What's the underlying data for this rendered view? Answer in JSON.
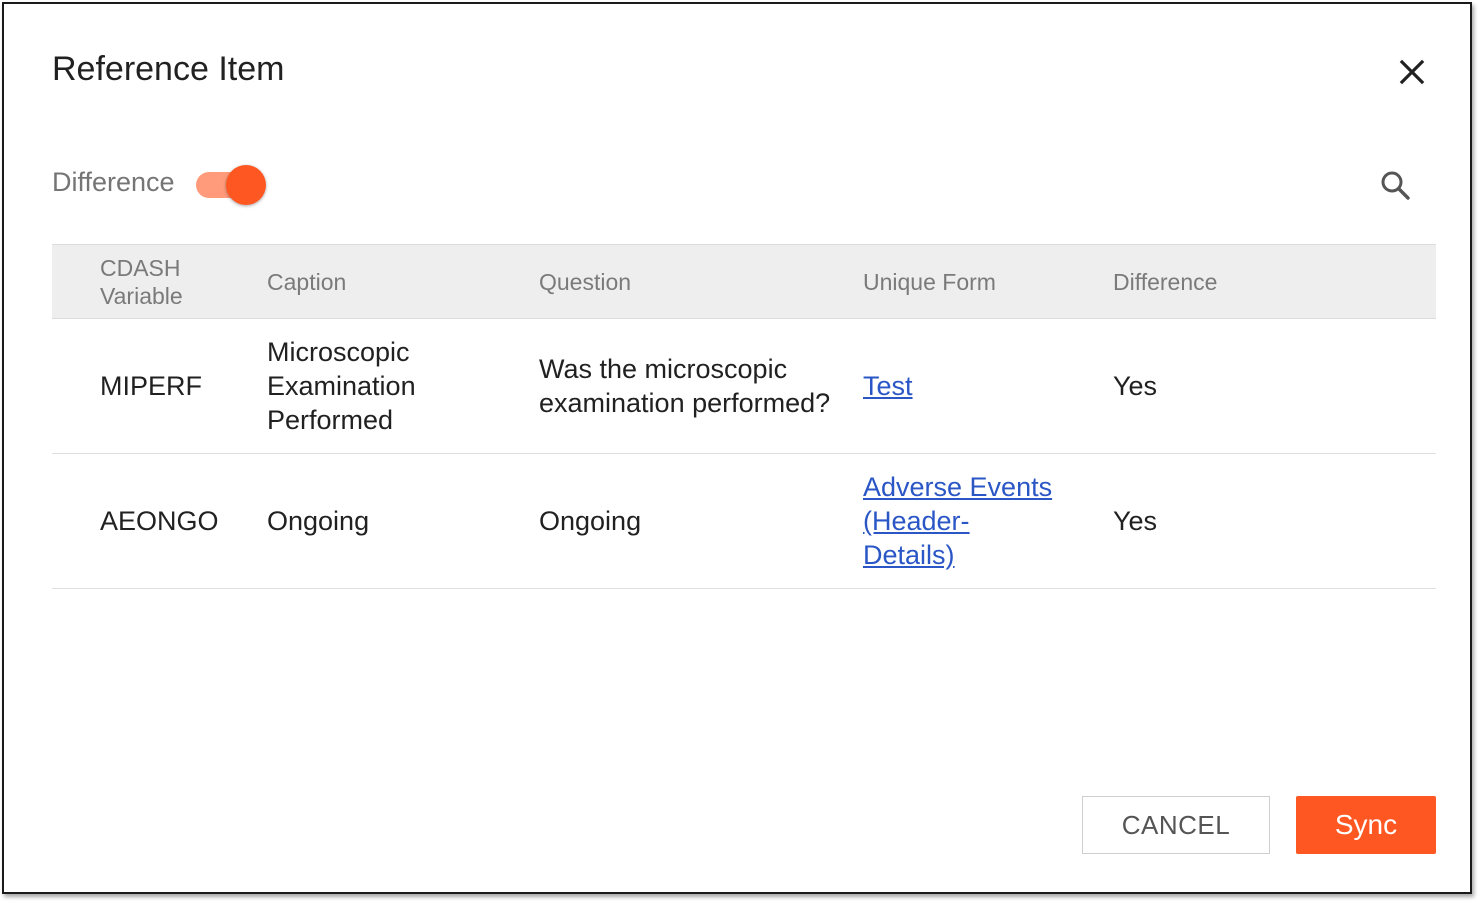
{
  "dialog": {
    "title": "Reference Item"
  },
  "toolbar": {
    "toggle_label": "Difference",
    "toggle_on": true
  },
  "table": {
    "headers": {
      "cdash_line1": "CDASH",
      "cdash_line2": "Variable",
      "caption": "Caption",
      "question": "Question",
      "unique_form": "Unique Form",
      "difference": "Difference"
    },
    "rows": [
      {
        "cdash_variable": "MIPERF",
        "caption": "Microscopic Examination Performed",
        "question": "Was the microscopic examination performed?",
        "unique_form": "Test",
        "difference": "Yes"
      },
      {
        "cdash_variable": "AEONGO",
        "caption": "Ongoing",
        "question": "Ongoing",
        "unique_form": "Adverse Events (Header-Details)",
        "difference": "Yes"
      }
    ]
  },
  "footer": {
    "cancel_label": "CANCEL",
    "sync_label": "Sync"
  },
  "colors": {
    "accent": "#ff5722",
    "accent_light": "#ff9b7a",
    "link": "#2a56c6",
    "header_bg": "#eeeeee"
  }
}
